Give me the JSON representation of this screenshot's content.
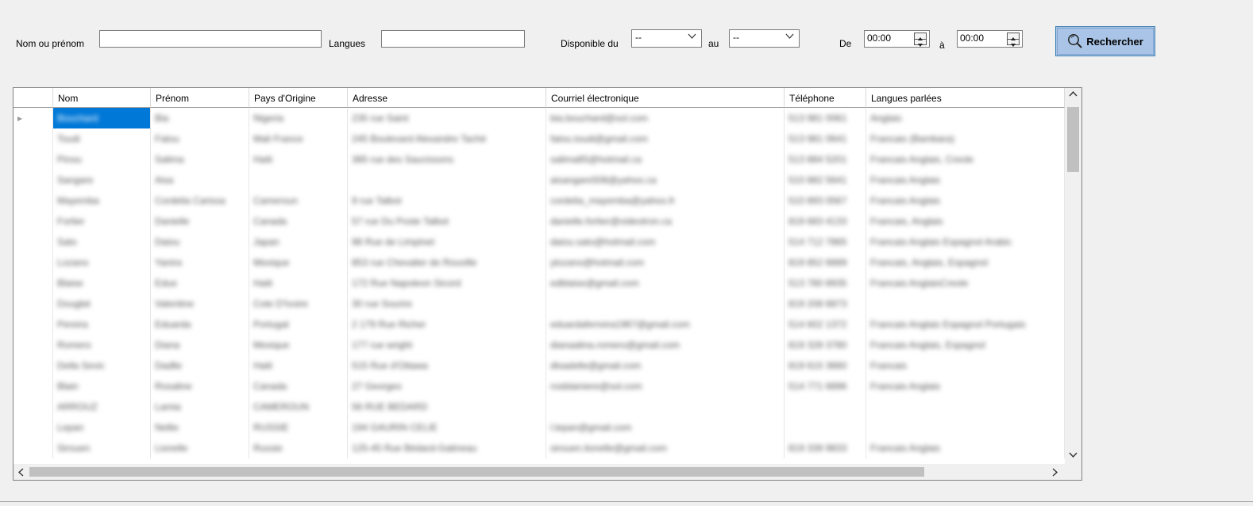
{
  "filters": {
    "name_label": "Nom ou prénom",
    "languages_label": "Langues",
    "available_label": "Disponible du",
    "from_value": "--",
    "to_label": "au",
    "to_value": "--",
    "de_label": "De",
    "time_from": "00:00",
    "a_label": "à",
    "time_to": "00:00"
  },
  "search_button": {
    "label": "Rechercher",
    "icon": "magnifier-icon"
  },
  "grid": {
    "columns": [
      "",
      "Nom",
      "Prénom",
      "Pays d'Origine",
      "Adresse",
      "Courriel électronique",
      "Téléphone",
      "Langues parlées"
    ],
    "rows": [
      [
        "Bouchard",
        "Bia",
        "Nigeria",
        "235 rue Saint",
        "bia.bouchard@sol.com",
        "513 981 0061",
        "Anglais"
      ],
      [
        "Toudi",
        "Fatou",
        "Mali France",
        "245 Boulevard Alexandre Taché",
        "fatou.toudi@gmail.com",
        "513 981 0641",
        "Francais (Bambara)"
      ],
      [
        "Pinou",
        "Salima",
        "Haiti",
        "385 rue des Saucissons",
        "salima85@hotmail.ca",
        "513 884 5201",
        "Francais Anglais, Creole"
      ],
      [
        "Sangare",
        "Aisa",
        "",
        "",
        "aisangare508@yahoo.ca",
        "510 882 5641",
        "Francais Anglais"
      ],
      [
        "Mayemba",
        "Cordelia Carissa",
        "Cameroun",
        "9 rue Talbot",
        "cordelia_mayemba@yahoo.fr",
        "510 893 0567",
        "Francais Anglais"
      ],
      [
        "Fortier",
        "Danielle",
        "Canada",
        "57 rue Du Poste Talbot",
        "danielle.fortier@videotron.ca",
        "819 683 4133",
        "Francais, Anglais"
      ],
      [
        "Sato",
        "Daiou",
        "Japan",
        "98 Rue de Limpinet",
        "daiou.sato@hotmail.com",
        "514 712 7865",
        "Francais Anglais Espagnol Arabic"
      ],
      [
        "Lozano",
        "Yanira",
        "Mexique",
        "853 rue Chevalier de Rouville",
        "ylozano@hotmail.com",
        "819 852 6689",
        "Francais, Anglais, Espagnol"
      ],
      [
        "Blaise",
        "Edue",
        "Haiti",
        "172 Rue Napoleon Sicord",
        "edblaise@gmail.com",
        "513 780 8935",
        "Francais AnglaisCreole"
      ],
      [
        "Dougbé",
        "Valentine",
        "Cote D'Ivoire",
        "30 rue Sourire",
        "",
        "819 208 6873",
        ""
      ],
      [
        "Pereira",
        "Eduarda",
        "Portugal",
        "2 179 Rue Richer",
        "eduardaferreira1967@gmail.com",
        "514 602 1372",
        "Francais Anglais Espagnol Portugais"
      ],
      [
        "Romero",
        "Diana",
        "Mexique",
        "177 rue wright",
        "dianaalina.romero@gmail.com",
        "819 328 3780",
        "Francais Anglais, Espagnol"
      ],
      [
        "Della Sevic",
        "Dadlle",
        "Haiti",
        "515 Rue d'Ottawa",
        "dlsadelle@gmail.com",
        "819 615 3660",
        "Francais"
      ],
      [
        "Blain",
        "Rosaline",
        "Canada",
        "27 Georges",
        "rosblainiere@sol.com",
        "514 771 6896",
        "Francais Anglais"
      ],
      [
        "ARROUZ",
        "Lamia",
        "CAMEROUN",
        "56 RUE BEDARD",
        "",
        "",
        ""
      ],
      [
        "Lepan",
        "Nellie",
        "RUSSIE",
        "194 GAURIN CELIE",
        "l.lepan@gmail.com",
        "",
        ""
      ],
      [
        "Sirouen",
        "Lionelle",
        "Russie",
        "125-45 Rue Bédard-Gatineau",
        "sirouen.lionelle@gmail.com",
        "819 339 9833",
        "Francais Anglais"
      ]
    ]
  }
}
